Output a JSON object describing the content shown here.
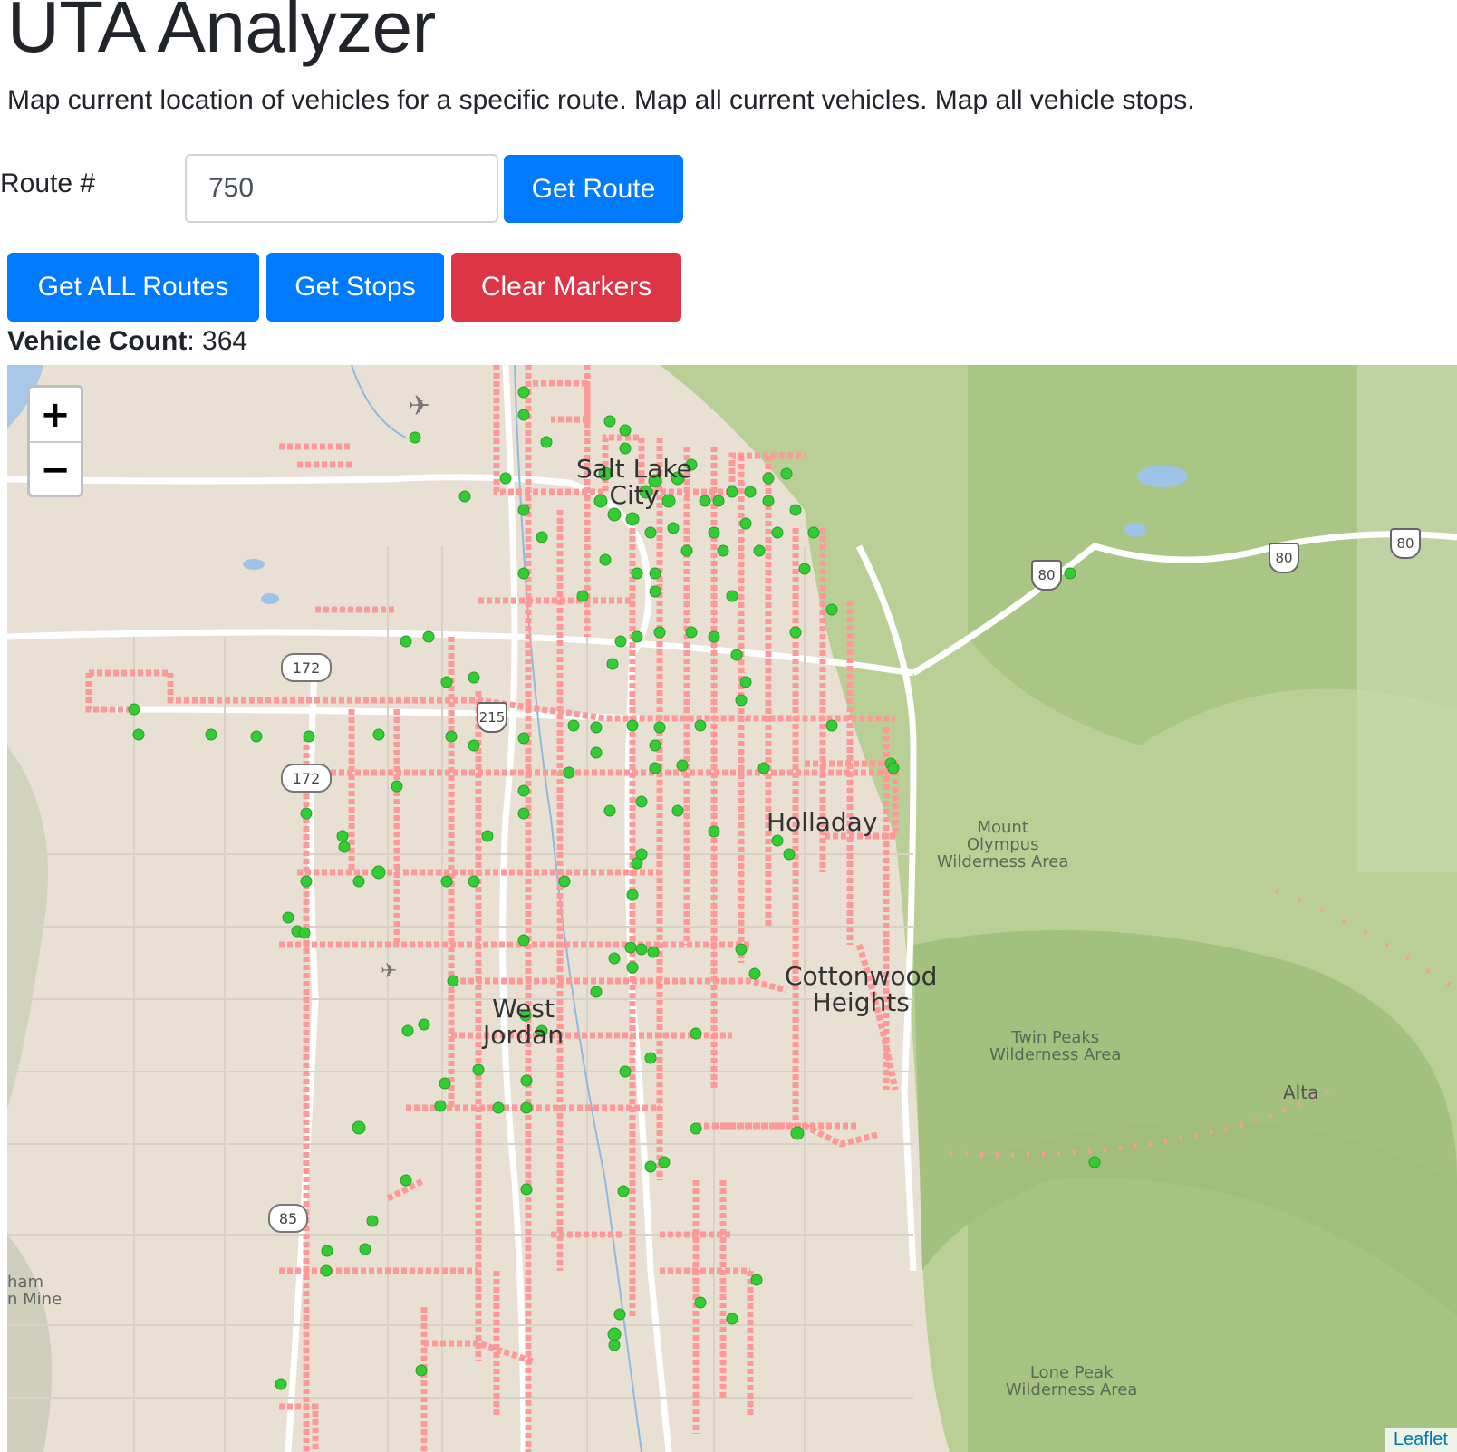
{
  "header": {
    "title": "UTA Analyzer",
    "description": "Map current location of vehicles for a specific route. Map all current vehicles. Map all vehicle stops."
  },
  "route_form": {
    "label": "Route #",
    "value": "750",
    "submit_label": "Get Route"
  },
  "actions": {
    "get_all_routes_label": "Get ALL Routes",
    "get_stops_label": "Get Stops",
    "clear_markers_label": "Clear Markers"
  },
  "vehicle_count": {
    "label": "Vehicle Count",
    "value": "364"
  },
  "map": {
    "zoom_in": "+",
    "zoom_out": "−",
    "attribution": "Leaflet",
    "labels": {
      "city_slc_1": "Salt Lake",
      "city_slc_2": "City",
      "holladay": "Holladay",
      "cottonwood_1": "Cottonwood",
      "cottonwood_2": "Heights",
      "west_jordan_1": "West",
      "west_jordan_2": "Jordan",
      "alta": "Alta",
      "olympus_1": "Mount",
      "olympus_2": "Olympus",
      "olympus_3": "Wilderness Area",
      "twin_1": "Twin Peaks",
      "twin_2": "Wilderness Area",
      "lone_1": "Lone Peak",
      "lone_2": "Wilderness Area",
      "mine_1": "ham",
      "mine_2": "n Mine"
    },
    "shields": {
      "sr172_top": "172",
      "sr172_mid": "172",
      "i215": "215",
      "sr85": "85",
      "i80_a": "80",
      "i80_b": "80",
      "i80_c": "80"
    },
    "stop_marker_color": "#ff9999",
    "vehicle_marker_color": "#33cc33"
  }
}
